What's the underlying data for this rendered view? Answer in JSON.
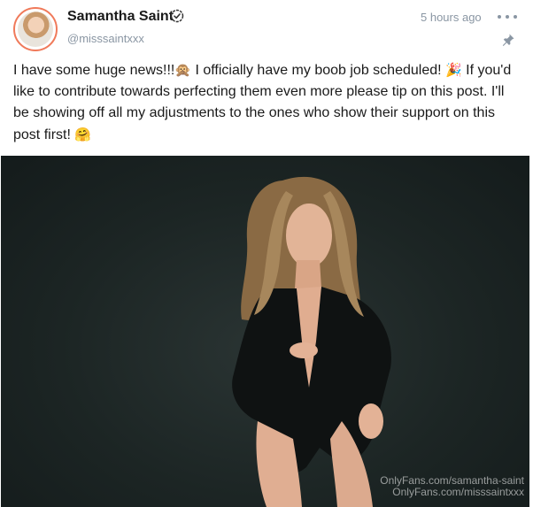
{
  "post": {
    "author": {
      "name": "Samantha Saint",
      "handle": "@misssaintxxx"
    },
    "timestamp": "5 hours ago",
    "caption": {
      "part1": "I have some huge news!!!",
      "emoji1": "🙊",
      "part2": " I officially have my boob job scheduled! ",
      "emoji2": "🎉",
      "part3": " If you'd like to contribute towards perfecting them even more please tip on this post. I'll be showing off all my adjustments to the ones who show their support on this post first! ",
      "emoji3": "🤗"
    },
    "media": {
      "watermark_line1": "OnlyFans.com/samantha-saint",
      "watermark_line2": "OnlyFans.com/misssaintxxx"
    }
  },
  "icons": {
    "verified": "verified-check-icon",
    "more": "more-dots-icon",
    "pin": "pin-icon"
  },
  "colors": {
    "avatar_ring": "#f07a5a",
    "muted_text": "#8a96a3",
    "photo_background": "#1c2524"
  }
}
